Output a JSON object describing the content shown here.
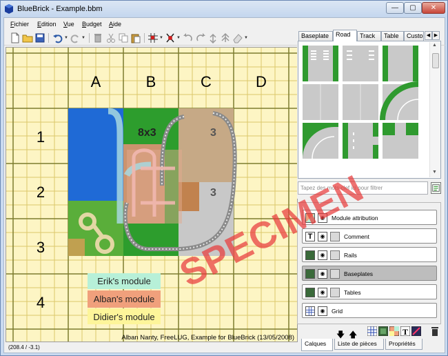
{
  "window": {
    "title": "BlueBrick - Example.bbm",
    "min_glyph": "—",
    "max_glyph": "▢",
    "close_glyph": "✕"
  },
  "menu": [
    "Fichier",
    "Edition",
    "Vue",
    "Budget",
    "Aide"
  ],
  "toolbar_icons": [
    "new-file-icon",
    "open-folder-icon",
    "save-icon",
    "undo-icon",
    "redo-icon",
    "delete-icon",
    "cut-icon",
    "copy-icon",
    "paste-icon",
    "snap-grid-icon",
    "rotation-step-icon",
    "rotate-left-icon",
    "rotate-right-icon",
    "send-to-back-icon",
    "bring-to-front-icon",
    "eraser-icon"
  ],
  "map": {
    "columns": [
      "A",
      "B",
      "C",
      "D"
    ],
    "rows": [
      "1",
      "2",
      "3",
      "4"
    ],
    "plate_label": "8x3",
    "plate_label_2": "3",
    "legend": [
      "Erik's module",
      "Alban's module",
      "Didier's module"
    ],
    "credit": "Alban Nanty, FreeLUG, Example for BlueBrick (13/05/2008)"
  },
  "status": {
    "coords": "(208.4 / -3.1)"
  },
  "palette": {
    "tabs": [
      "Baseplate",
      "Road",
      "Track",
      "Table",
      "Custom"
    ],
    "active_tab": "Road",
    "filter_placeholder": "Tapez des mots-clef ici pour filtrer"
  },
  "layers": [
    {
      "name": "Module attribution",
      "type": "area"
    },
    {
      "name": "Comment",
      "type": "text"
    },
    {
      "name": "Rails",
      "type": "brick"
    },
    {
      "name": "Baseplates",
      "type": "brick",
      "selected": true
    },
    {
      "name": "Tables",
      "type": "brick"
    },
    {
      "name": "Grid",
      "type": "grid"
    }
  ],
  "bottom_tabs": [
    "Calques",
    "Liste de pièces",
    "Propriétés"
  ],
  "watermark": "SPECIMEN",
  "colors": {
    "grid_bg": "#fdf5c4",
    "grid_major": "#8a8a3a",
    "green_plate": "#2d9d2d",
    "blue_plate": "#1f6ad6",
    "gray_plate": "#c8c8c8",
    "erik": "#b7f0d8",
    "alban": "#f0a07c",
    "didier": "#fdf59a"
  }
}
